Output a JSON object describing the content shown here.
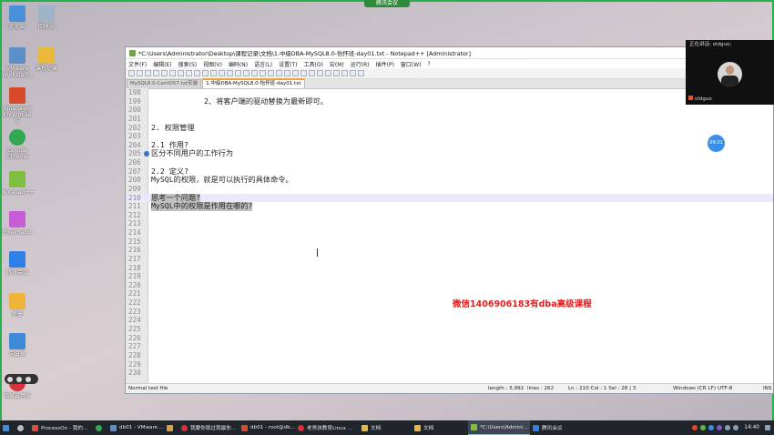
{
  "meeting_indicator": "腾讯会议",
  "desktop_icons": [
    {
      "label": "此电脑",
      "color": "#4a90d9"
    },
    {
      "label": "回收站",
      "color": "#9fb4c8"
    },
    {
      "label": "VMware Workstati...",
      "color": "#5b8fc7"
    },
    {
      "label": "课程记录",
      "color": "#e8b93a"
    },
    {
      "label": "Xmanager Enterprise 5",
      "color": "#d84a2b"
    },
    {
      "label": "Google Chrome",
      "color": "#33a852"
    },
    {
      "label": "Notepad++",
      "color": "#7fbf3f"
    },
    {
      "label": "Pixelmator",
      "color": "#c85bd6"
    },
    {
      "label": "腾讯会议",
      "color": "#2f7fe9"
    },
    {
      "label": "遥墨",
      "color": "#f0b43a"
    },
    {
      "label": "向日葵",
      "color": "#3e8ad6"
    },
    {
      "label": "网易云音乐",
      "color": "#d6333a"
    }
  ],
  "notepad": {
    "title": "*C:\\Users\\Administrator\\Desktop\\课程记录\\文档\\1.中级DBA-MySQL8.0-怡怀班-day01.txt - Notepad++ [Administrator]",
    "menu": [
      "文件(F)",
      "编辑(E)",
      "搜索(S)",
      "视图(V)",
      "编码(N)",
      "语言(L)",
      "设置(T)",
      "工具(O)",
      "宏(M)",
      "运行(R)",
      "插件(P)",
      "窗口(W)",
      "?"
    ],
    "tabs": [
      {
        "label": "MySQL8.0-CentOS7.txt安装",
        "active": false
      },
      {
        "label": "1.中级DBA-MySQL8.0-怡怀班-day01.txt",
        "active": true
      }
    ],
    "lines": [
      {
        "n": "198",
        "text": ""
      },
      {
        "n": "199",
        "text": "2、将客户端的驱动替换为最新即可。",
        "indent": true
      },
      {
        "n": "200",
        "text": ""
      },
      {
        "n": "201",
        "text": ""
      },
      {
        "n": "202",
        "text": "2. 权限管理"
      },
      {
        "n": "203",
        "text": ""
      },
      {
        "n": "204",
        "text": "2.1 作用?"
      },
      {
        "n": "205",
        "text": "区分不同用户的工作行为",
        "bookmark": true
      },
      {
        "n": "206",
        "text": ""
      },
      {
        "n": "207",
        "text": "2.2 定义?"
      },
      {
        "n": "208",
        "text": "MySQL的权限，就是可以执行的具体命令。"
      },
      {
        "n": "209",
        "text": ""
      },
      {
        "n": "210",
        "text": "思考一个问题?",
        "selected": true,
        "current": true
      },
      {
        "n": "211",
        "text": "MySQL中的权限是作用在哪的?",
        "selected": true
      },
      {
        "n": "212",
        "text": ""
      },
      {
        "n": "213",
        "text": ""
      },
      {
        "n": "214",
        "text": ""
      },
      {
        "n": "215",
        "text": ""
      },
      {
        "n": "216",
        "text": ""
      },
      {
        "n": "217",
        "text": ""
      },
      {
        "n": "218",
        "text": ""
      },
      {
        "n": "219",
        "text": ""
      },
      {
        "n": "220",
        "text": ""
      },
      {
        "n": "221",
        "text": ""
      },
      {
        "n": "222",
        "text": ""
      },
      {
        "n": "223",
        "text": ""
      },
      {
        "n": "224",
        "text": ""
      },
      {
        "n": "225",
        "text": ""
      },
      {
        "n": "226",
        "text": ""
      },
      {
        "n": "227",
        "text": ""
      },
      {
        "n": "228",
        "text": ""
      },
      {
        "n": "229",
        "text": ""
      },
      {
        "n": "230",
        "text": ""
      }
    ],
    "watermark": "微信1406906183有dba高级课程",
    "status": {
      "type": "Normal text file",
      "length": "length : 5,992",
      "lines": "lines : 262",
      "pos": "Ln : 210    Col : 1    Sel : 28 | 3",
      "eol": "Windows (CR LF)",
      "encoding": "UTF-8",
      "mode": "INS"
    }
  },
  "meeting": {
    "speaking": "正在讲话: oldguo;",
    "name": "oldguo",
    "bubble": "09:31"
  },
  "taskbar": {
    "items": [
      {
        "label": "",
        "color": "#3a8ee6"
      },
      {
        "label": "",
        "color": "#bbbbbb"
      },
      {
        "label": "ProcessOn - 我的...",
        "color": "#e04b3a"
      },
      {
        "label": "",
        "color": "#33a852"
      },
      {
        "label": "db01 - VMware ...",
        "color": "#5b8fc7"
      },
      {
        "label": "",
        "color": "#d6a23a"
      },
      {
        "label": "我要你就过我最你...",
        "color": "#d6333a"
      },
      {
        "label": "db01 - root@db...",
        "color": "#d84a2b"
      },
      {
        "label": "老男孩教育Linux ...",
        "color": "#d6333a"
      },
      {
        "label": "文档",
        "color": "#e8b93a"
      },
      {
        "label": "文档",
        "color": "#e8b93a"
      },
      {
        "label": "*C:\\Users\\Admini...",
        "color": "#7fbf3f"
      },
      {
        "label": "腾讯会议",
        "color": "#2f7fe9"
      }
    ],
    "clock": "14:40"
  }
}
